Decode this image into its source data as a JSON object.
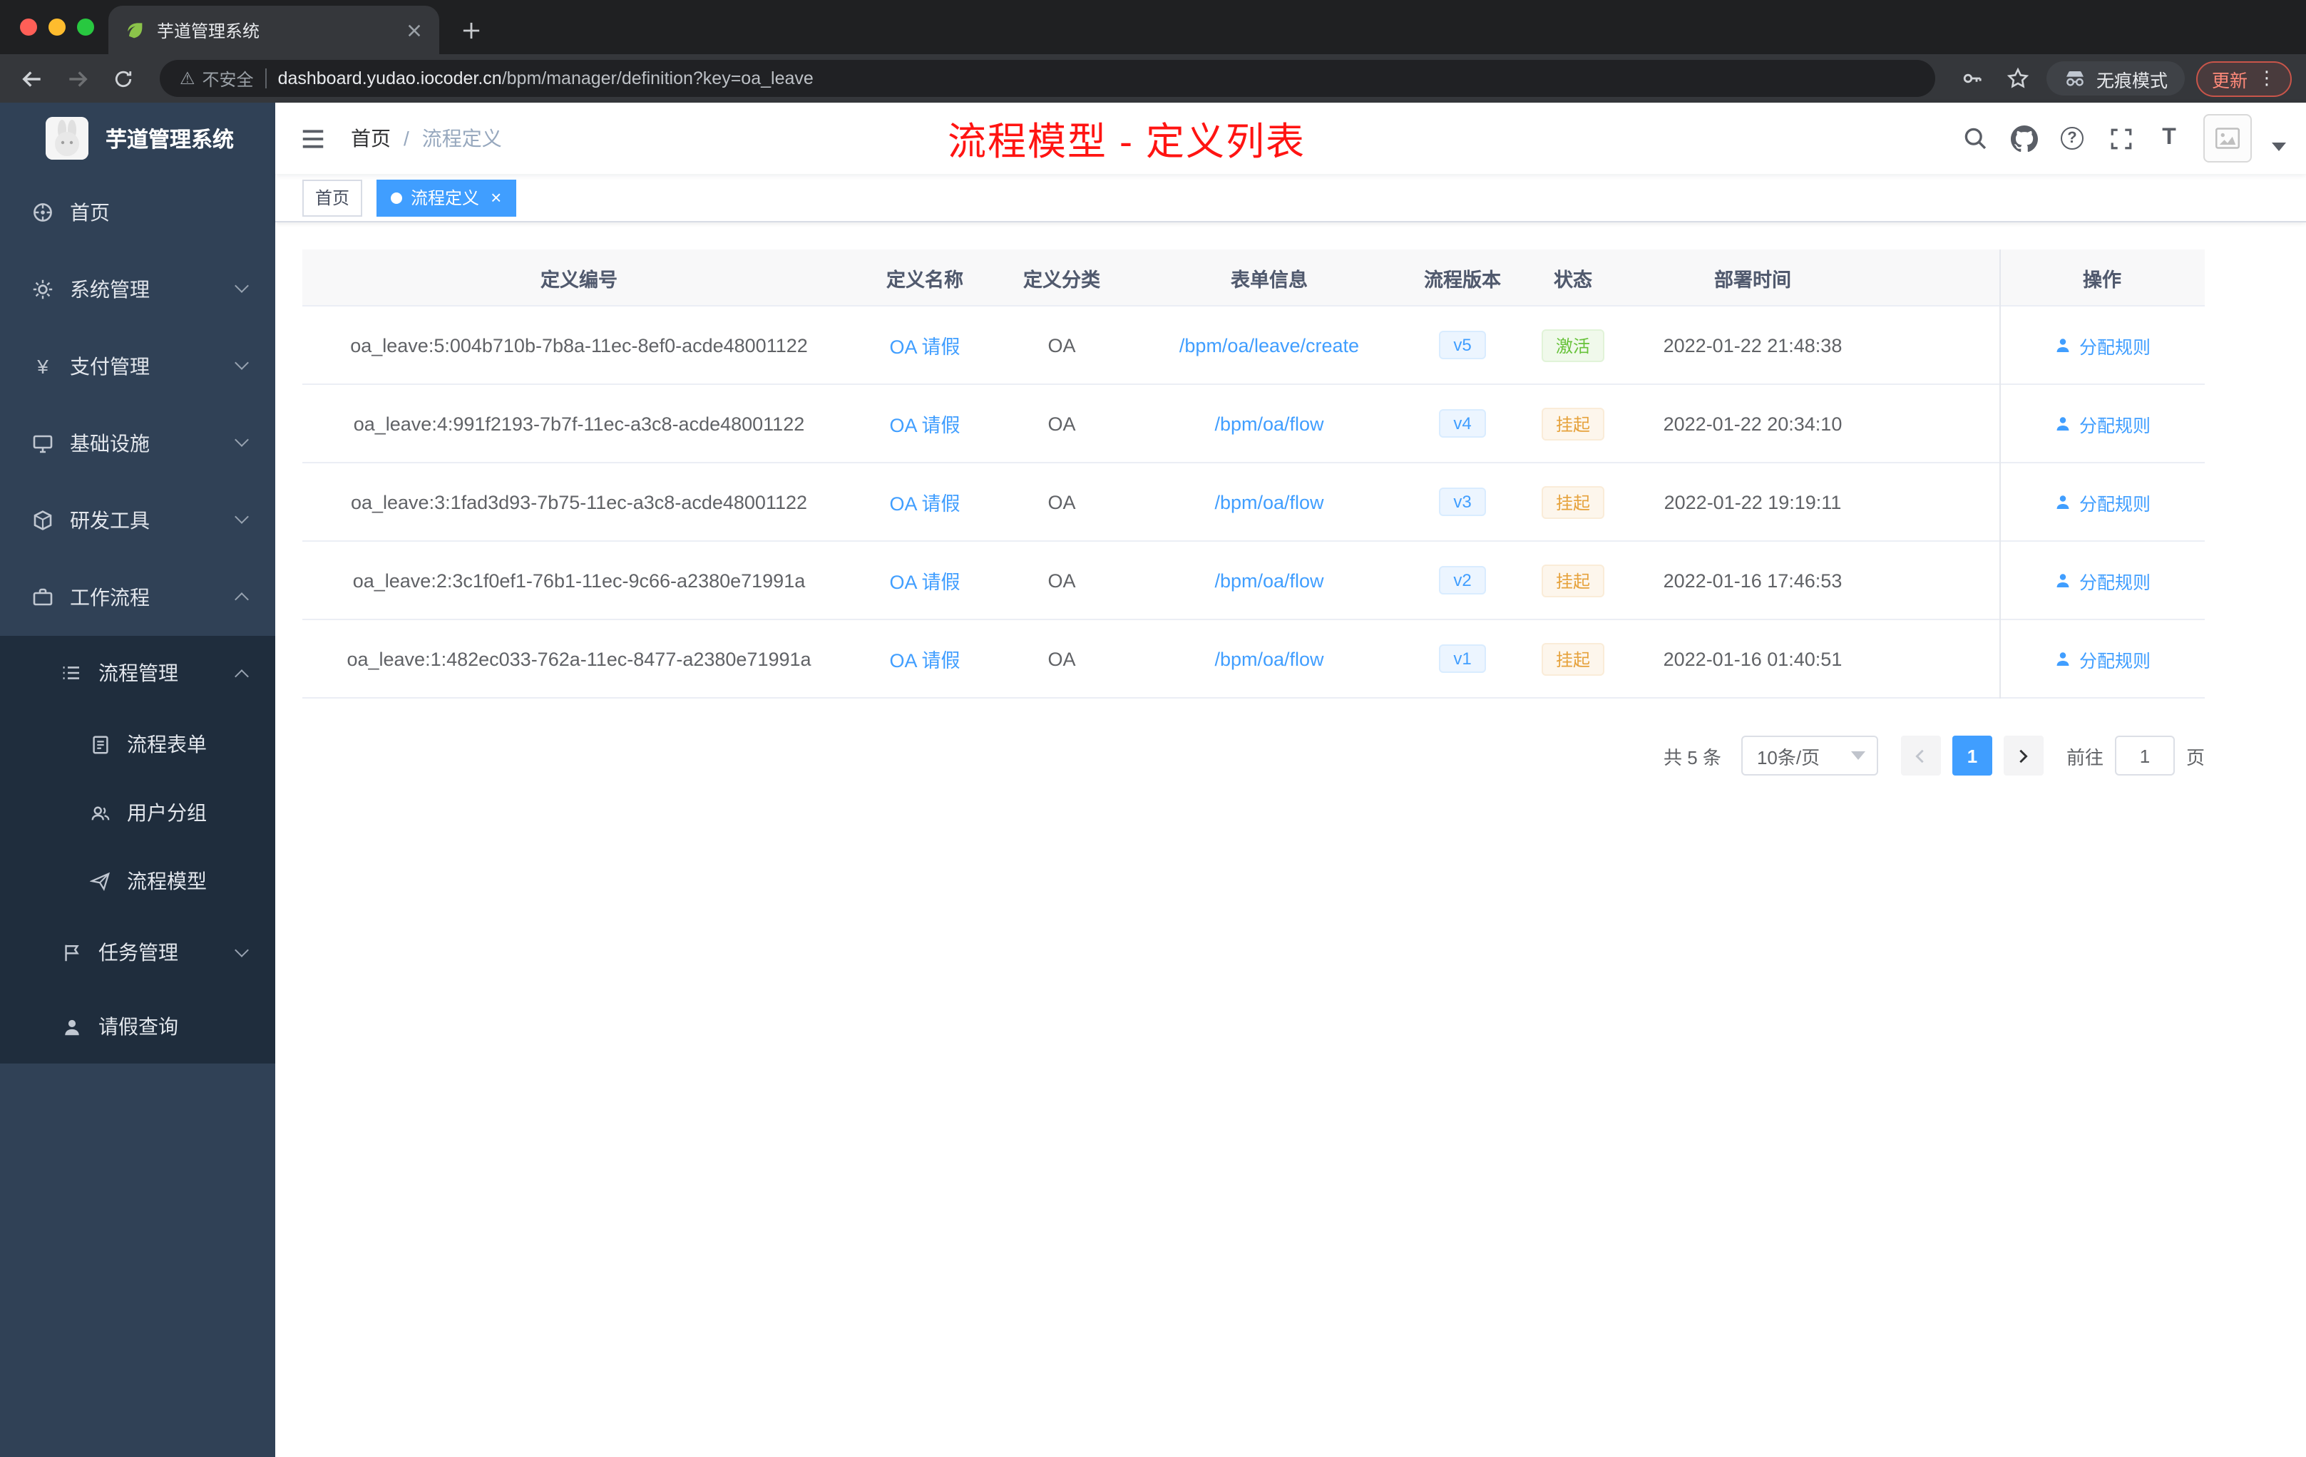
{
  "colors": {
    "accent_blue": "#409eff",
    "status_active_green": "#67c23a",
    "status_suspended_orange": "#e6a23c",
    "overlay_title_red": "#ff1412",
    "sidebar_bg": "#304156",
    "sidebar_submenu_bg": "#1f2d3d",
    "active_tag_bg": "#409eff"
  },
  "browser": {
    "tab_title": "芋道管理系统",
    "security_label": "不安全",
    "url_host": "dashboard.yudao.iocoder.cn",
    "url_path": "/bpm/manager/definition?key=oa_leave",
    "incognito_label": "无痕模式",
    "update_label": "更新"
  },
  "icons": {
    "warning_glyph": "⚠",
    "more_glyph": "⋮",
    "help_glyph": "?",
    "fontsize_glyph": "T",
    "yen_glyph": "¥"
  },
  "sidebar": {
    "logo_title": "芋道管理系统",
    "items": [
      {
        "label": "首页"
      },
      {
        "label": "系统管理"
      },
      {
        "label": "支付管理"
      },
      {
        "label": "基础设施"
      },
      {
        "label": "研发工具"
      },
      {
        "label": "工作流程"
      },
      {
        "label": "流程管理"
      },
      {
        "label": "流程表单"
      },
      {
        "label": "用户分组"
      },
      {
        "label": "流程模型"
      },
      {
        "label": "任务管理"
      },
      {
        "label": "请假查询"
      }
    ]
  },
  "header": {
    "breadcrumb": [
      {
        "label": "首页"
      },
      {
        "label": "流程定义"
      }
    ],
    "breadcrumb_sep": "/",
    "overlay_title": "流程模型 - 定义列表"
  },
  "tags": [
    {
      "label": "首页"
    },
    {
      "label": "流程定义",
      "close": "×"
    }
  ],
  "table": {
    "columns": [
      "定义编号",
      "定义名称",
      "定义分类",
      "表单信息",
      "流程版本",
      "状态",
      "部署时间",
      "操作"
    ],
    "rows": [
      {
        "id": "oa_leave:5:004b710b-7b8a-11ec-8ef0-acde48001122",
        "name": "OA 请假",
        "category": "OA",
        "form": "/bpm/oa/leave/create",
        "version": "v5",
        "status": "激活",
        "status_type": "active",
        "deploy_time": "2022-01-22 21:48:38",
        "action": "分配规则"
      },
      {
        "id": "oa_leave:4:991f2193-7b7f-11ec-a3c8-acde48001122",
        "name": "OA 请假",
        "category": "OA",
        "form": "/bpm/oa/flow",
        "version": "v4",
        "status": "挂起",
        "status_type": "suspended",
        "deploy_time": "2022-01-22 20:34:10",
        "action": "分配规则"
      },
      {
        "id": "oa_leave:3:1fad3d93-7b75-11ec-a3c8-acde48001122",
        "name": "OA 请假",
        "category": "OA",
        "form": "/bpm/oa/flow",
        "version": "v3",
        "status": "挂起",
        "status_type": "suspended",
        "deploy_time": "2022-01-22 19:19:11",
        "action": "分配规则"
      },
      {
        "id": "oa_leave:2:3c1f0ef1-76b1-11ec-9c66-a2380e71991a",
        "name": "OA 请假",
        "category": "OA",
        "form": "/bpm/oa/flow",
        "version": "v2",
        "status": "挂起",
        "status_type": "suspended",
        "deploy_time": "2022-01-16 17:46:53",
        "action": "分配规则"
      },
      {
        "id": "oa_leave:1:482ec033-762a-11ec-8477-a2380e71991a",
        "name": "OA 请假",
        "category": "OA",
        "form": "/bpm/oa/flow",
        "version": "v1",
        "status": "挂起",
        "status_type": "suspended",
        "deploy_time": "2022-01-16 01:40:51",
        "action": "分配规则"
      }
    ]
  },
  "pagination": {
    "total": "共 5 条",
    "page_size": "10条/页",
    "current": "1",
    "goto_label": "前往",
    "goto_value": "1",
    "unit": "页"
  }
}
